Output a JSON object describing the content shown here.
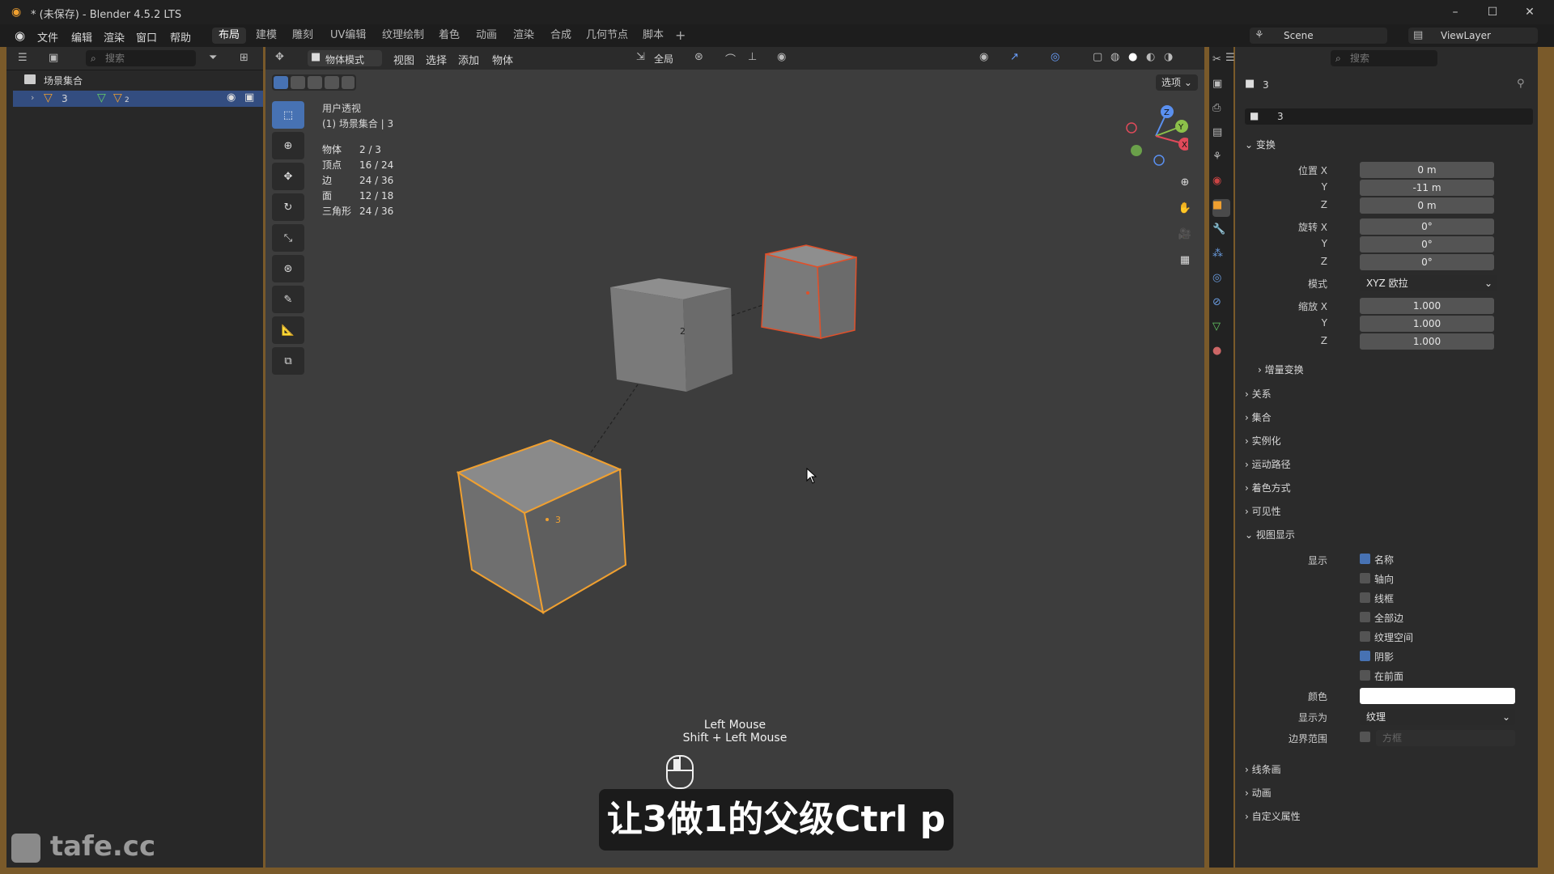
{
  "window": {
    "title": "* (未保存) - Blender 4.5.2 LTS"
  },
  "menu": {
    "items": [
      "文件",
      "编辑",
      "渲染",
      "窗口",
      "帮助"
    ]
  },
  "workspaces": [
    "布局",
    "建模",
    "雕刻",
    "UV编辑",
    "纹理绘制",
    "着色",
    "动画",
    "渲染",
    "合成",
    "几何节点",
    "脚本"
  ],
  "workspace_active": "布局",
  "scene": {
    "name": "Scene",
    "view_layer": "ViewLayer"
  },
  "outliner": {
    "search_placeholder": "搜索",
    "root": "场景集合",
    "row_label": "3",
    "row_child_count": "2"
  },
  "viewport": {
    "mode": "物体模式",
    "menus": [
      "视图",
      "选择",
      "添加",
      "物体"
    ],
    "orientation": "全局",
    "options_label": "选项",
    "view_name": "用户透视",
    "collection_line": "(1) 场景集合 | 3",
    "stats": [
      {
        "label": "物体",
        "value": "2 / 3"
      },
      {
        "label": "顶点",
        "value": "16 / 24"
      },
      {
        "label": "边",
        "value": "24 / 36"
      },
      {
        "label": "面",
        "value": "12 / 18"
      },
      {
        "label": "三角形",
        "value": "24 / 36"
      }
    ],
    "object_labels": {
      "cube2": "2",
      "cube3": "3"
    },
    "gizmo": {
      "z": "Z",
      "y": "Y",
      "x": "X"
    }
  },
  "mouse_hint": {
    "line1": "Left Mouse",
    "line2": "Shift + Left Mouse"
  },
  "caption": "让3做1的父级Ctrl p",
  "watermark": "tafe.cc",
  "properties": {
    "search_placeholder": "搜索",
    "object_name": "3",
    "object_field": "3",
    "transform_title": "变换",
    "location": {
      "label_x": "位置 X",
      "x": "0 m",
      "y": "-11 m",
      "z": "0 m"
    },
    "rotation": {
      "label_x": "旋转 X",
      "x": "0°",
      "y": "0°",
      "z": "0°"
    },
    "mode_label": "模式",
    "mode_value": "XYZ 欧拉",
    "scale": {
      "label_x": "缩放 X",
      "x": "1.000",
      "y": "1.000",
      "z": "1.000"
    },
    "axis_y": "Y",
    "axis_z": "Z",
    "delta_transform": "增量变换",
    "collapsed_panels": [
      "关系",
      "集合",
      "实例化",
      "运动路径",
      "着色方式",
      "可见性"
    ],
    "viewport_display_title": "视图显示",
    "show_label": "显示",
    "checkboxes": [
      {
        "label": "名称",
        "checked": true
      },
      {
        "label": "轴向",
        "checked": false
      },
      {
        "label": "线框",
        "checked": false
      },
      {
        "label": "全部边",
        "checked": false
      },
      {
        "label": "纹理空间",
        "checked": false
      },
      {
        "label": "阴影",
        "checked": true
      },
      {
        "label": "在前面",
        "checked": false
      }
    ],
    "color_label": "颜色",
    "color_value": "#ffffff",
    "display_as_label": "显示为",
    "display_as_value": "纹理",
    "bounds_label": "边界范围",
    "bounds_value": "方框",
    "bottom_panels": [
      "线条画",
      "动画",
      "自定义属性"
    ]
  },
  "colors": {
    "accent": "#4772b3",
    "active_outline": "#f0a030",
    "selected_outline": "#e0502a"
  }
}
